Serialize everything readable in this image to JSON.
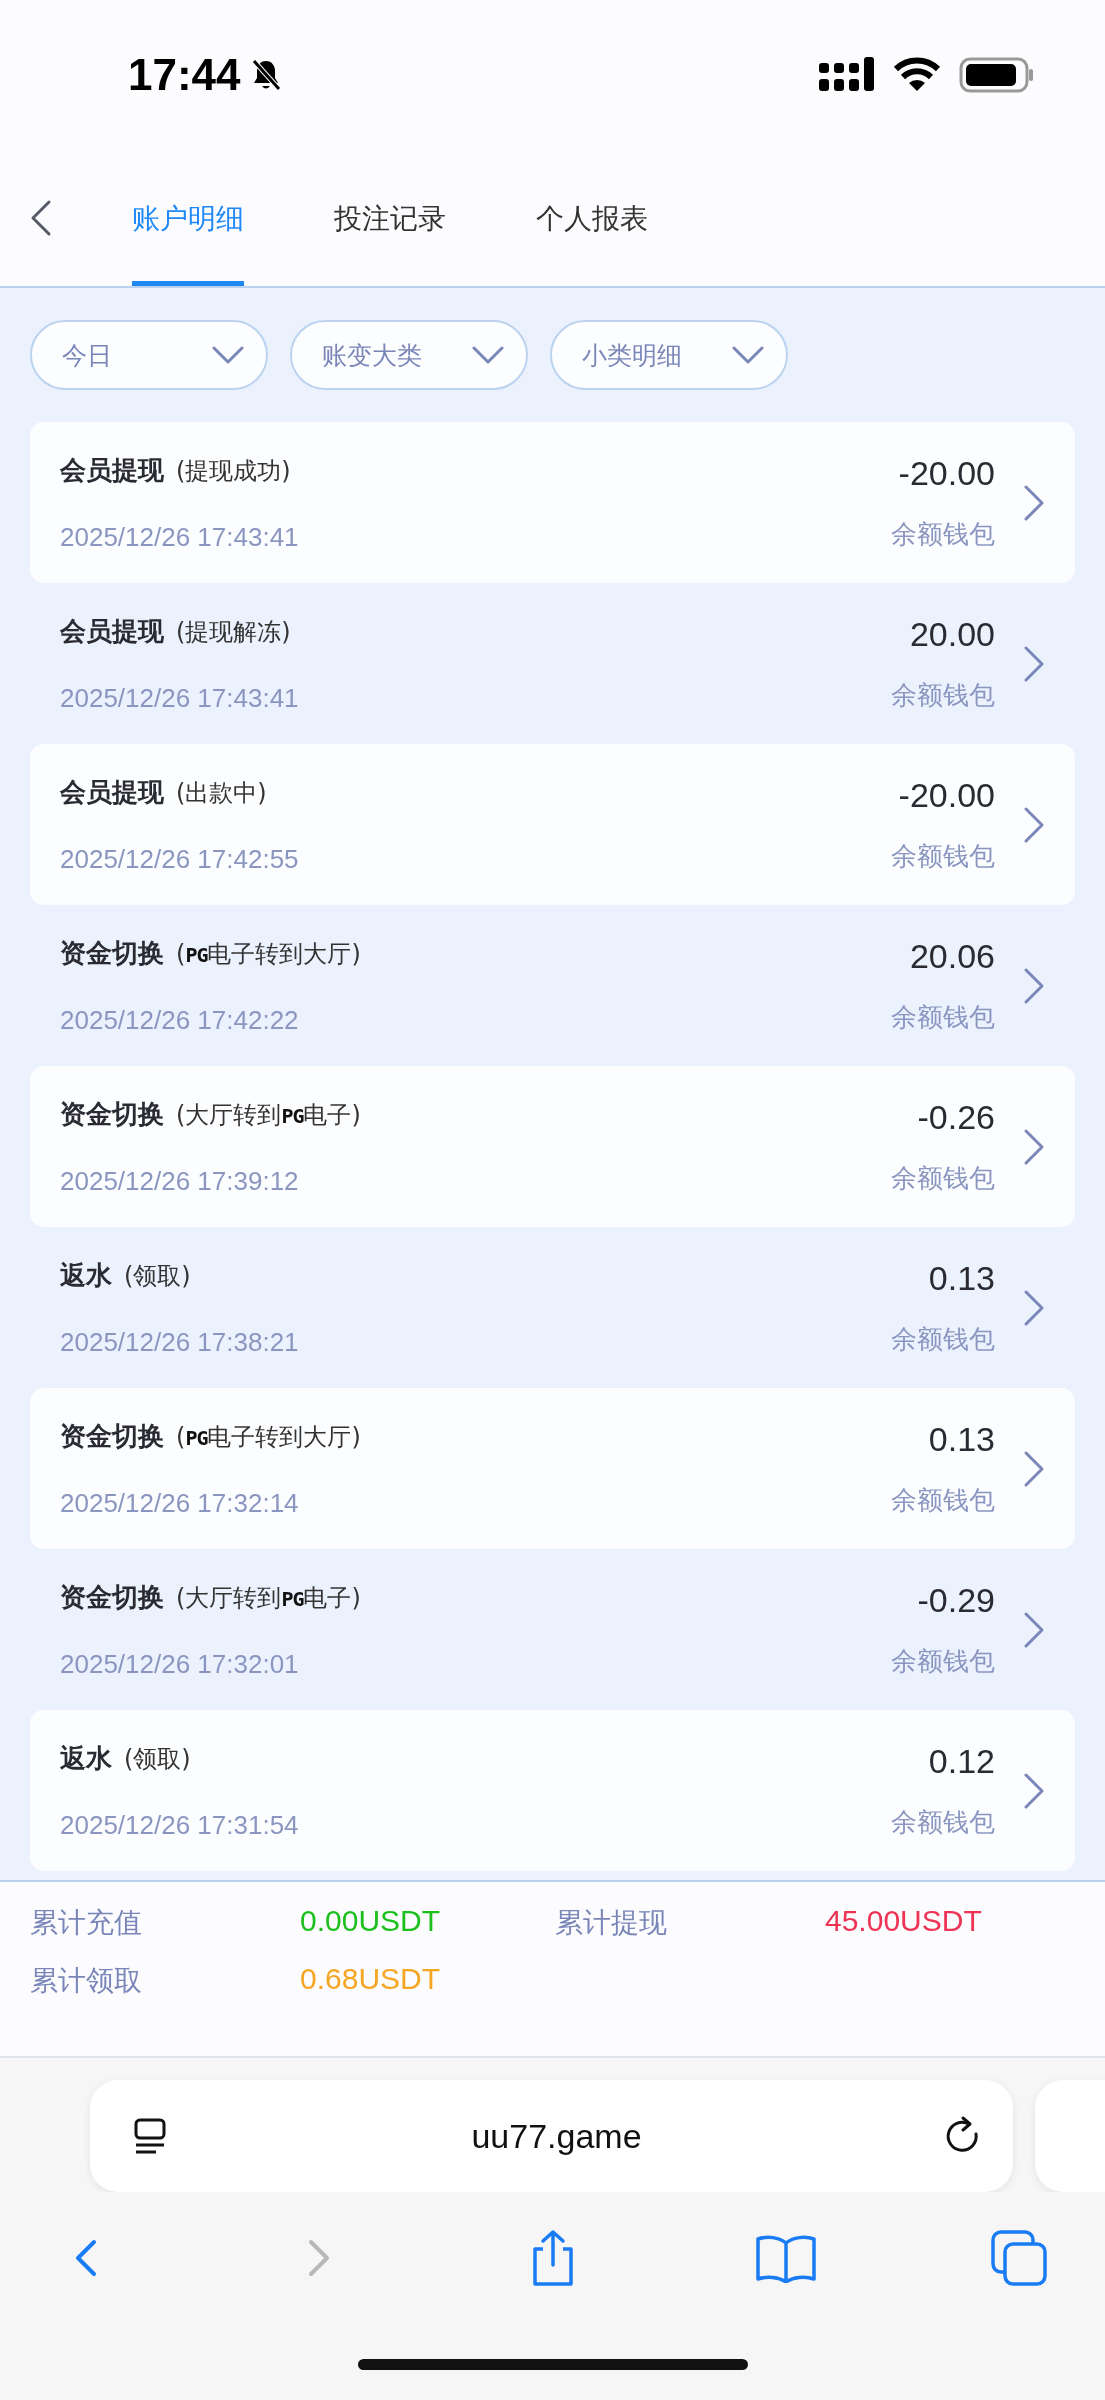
{
  "status_bar": {
    "time": "17:44"
  },
  "nav": {
    "tabs": [
      {
        "label": "账户明细",
        "selected": true
      },
      {
        "label": "投注记录",
        "selected": false
      },
      {
        "label": "个人报表",
        "selected": false
      }
    ]
  },
  "filters": [
    {
      "label": "今日"
    },
    {
      "label": "账变大类"
    },
    {
      "label": "小类明细"
    }
  ],
  "records": [
    {
      "title": "会员提现",
      "detail": [
        {
          "kind": "text",
          "text": "(提现成功)"
        }
      ],
      "time": "2025/12/26 17:43:41",
      "amount": "-20.00",
      "wallet": "余额钱包"
    },
    {
      "title": "会员提现",
      "detail": [
        {
          "kind": "text",
          "text": "(提现解冻)"
        }
      ],
      "time": "2025/12/26 17:43:41",
      "amount": "20.00",
      "wallet": "余额钱包"
    },
    {
      "title": "会员提现",
      "detail": [
        {
          "kind": "text",
          "text": "(出款中)"
        }
      ],
      "time": "2025/12/26 17:42:55",
      "amount": "-20.00",
      "wallet": "余额钱包"
    },
    {
      "title": "资金切换",
      "detail": [
        {
          "kind": "text",
          "text": "("
        },
        {
          "kind": "logo",
          "text": "PG"
        },
        {
          "kind": "text",
          "text": "电子转到大厅)"
        }
      ],
      "time": "2025/12/26 17:42:22",
      "amount": "20.06",
      "wallet": "余额钱包"
    },
    {
      "title": "资金切换",
      "detail": [
        {
          "kind": "text",
          "text": "(大厅转到"
        },
        {
          "kind": "logo",
          "text": "PG"
        },
        {
          "kind": "text",
          "text": "电子)"
        }
      ],
      "time": "2025/12/26 17:39:12",
      "amount": "-0.26",
      "wallet": "余额钱包"
    },
    {
      "title": "返水",
      "detail": [
        {
          "kind": "text",
          "text": "(领取)"
        }
      ],
      "time": "2025/12/26 17:38:21",
      "amount": "0.13",
      "wallet": "余额钱包"
    },
    {
      "title": "资金切换",
      "detail": [
        {
          "kind": "text",
          "text": "("
        },
        {
          "kind": "logo",
          "text": "PG"
        },
        {
          "kind": "text",
          "text": "电子转到大厅)"
        }
      ],
      "time": "2025/12/26 17:32:14",
      "amount": "0.13",
      "wallet": "余额钱包"
    },
    {
      "title": "资金切换",
      "detail": [
        {
          "kind": "text",
          "text": "(大厅转到"
        },
        {
          "kind": "logo",
          "text": "PG"
        },
        {
          "kind": "text",
          "text": "电子)"
        }
      ],
      "time": "2025/12/26 17:32:01",
      "amount": "-0.29",
      "wallet": "余额钱包"
    },
    {
      "title": "返水",
      "detail": [
        {
          "kind": "text",
          "text": "(领取)"
        }
      ],
      "time": "2025/12/26 17:31:54",
      "amount": "0.12",
      "wallet": "余额钱包"
    }
  ],
  "summary": [
    {
      "label": "累计充值",
      "value": "0.00USDT",
      "color": "#1cbf1c"
    },
    {
      "label": "累计提现",
      "value": "45.00USDT",
      "color": "#ee3355"
    },
    {
      "label": "累计领取",
      "value": "0.68USDT",
      "color": "#f5a623"
    }
  ],
  "browser": {
    "url": "uu77.game"
  }
}
